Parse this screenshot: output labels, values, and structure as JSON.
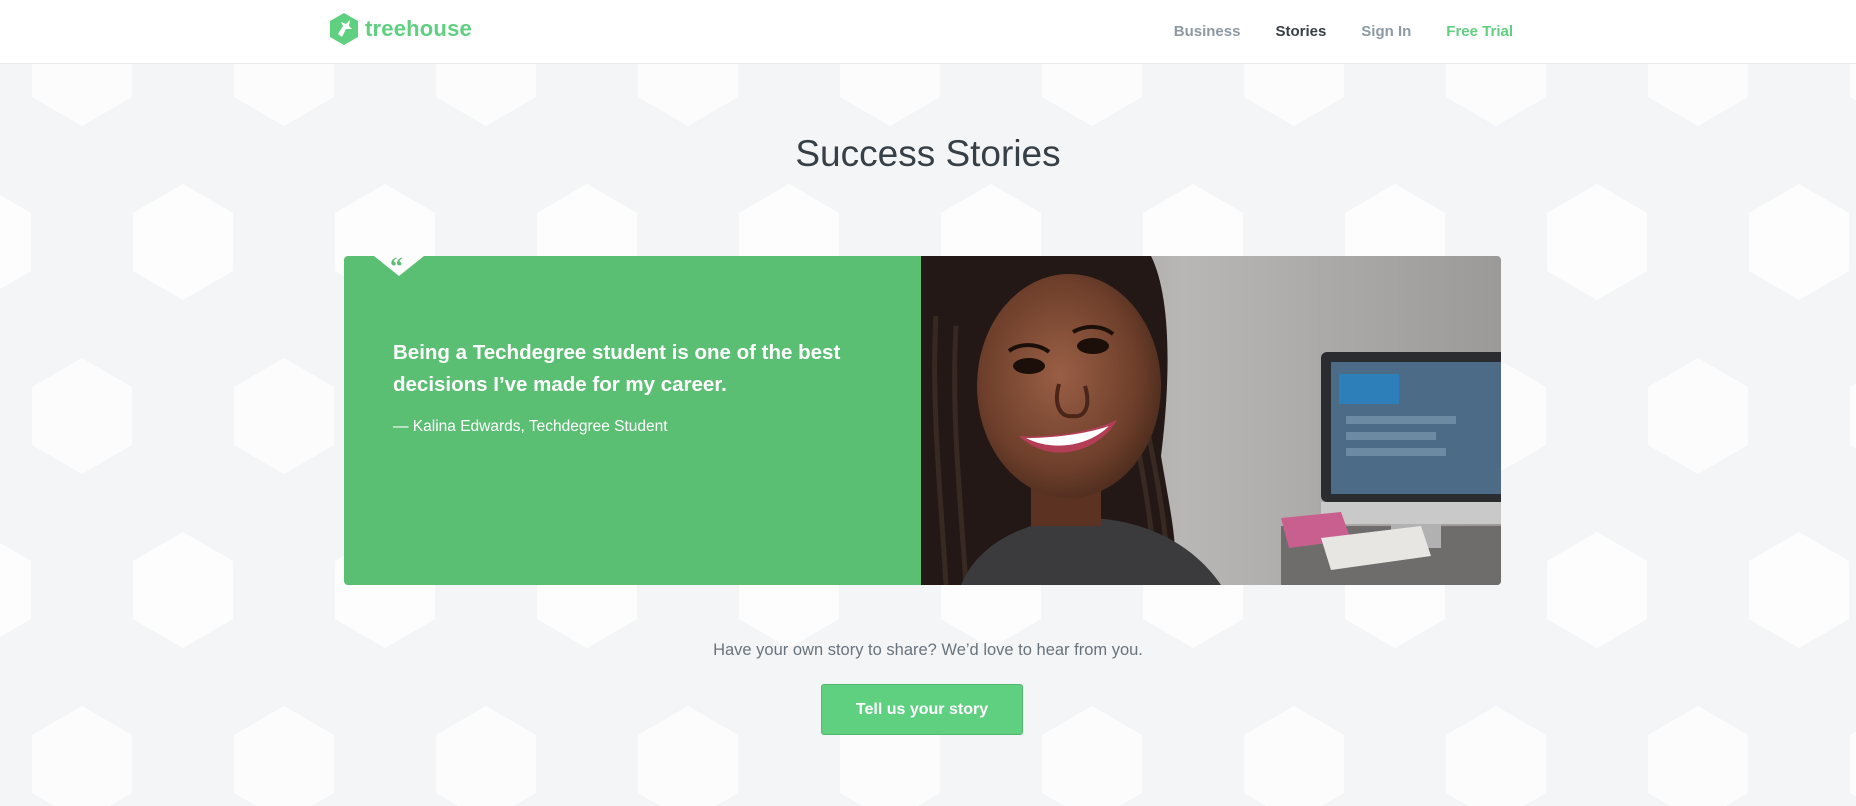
{
  "brand": {
    "name": "treehouse",
    "color": "#5fcf80"
  },
  "nav": {
    "items": [
      {
        "label": "Business"
      },
      {
        "label": "Stories"
      },
      {
        "label": "Sign In"
      },
      {
        "label": "Free Trial"
      }
    ]
  },
  "page": {
    "title": "Success Stories"
  },
  "testimonial": {
    "quote_mark": "“",
    "quote": "Being a Techdegree student is one of the best decisions I’ve made for my career.",
    "author": "— Kalina Edwards, Techdegree Student",
    "panel_color": "#5bbf73"
  },
  "share": {
    "text": "Have your own story to share? We’d love to hear from you.",
    "button_label": "Tell us your story"
  }
}
